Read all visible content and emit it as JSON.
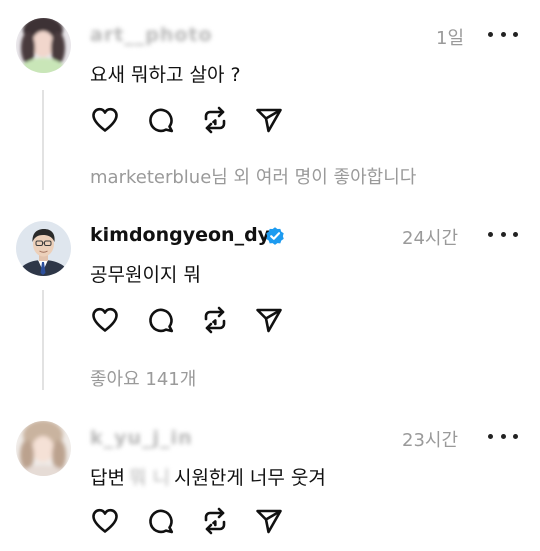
{
  "comments": [
    {
      "username": "art__photo",
      "time": "1일",
      "text": "요새 뭐하고 살아 ?",
      "likes_text": "marketerblue님 외 여러 명이 좋아합니다",
      "avatar_icon": "blurred-profile-photo"
    },
    {
      "username": "kimdongyeon_dy",
      "verified": true,
      "time": "24시간",
      "text": "공무원이지 뭐",
      "likes_text": "좋아요 141개",
      "avatar_icon": "man-in-suit-photo"
    },
    {
      "username": "k_yu_j_in",
      "time": "23시간",
      "text_before": "답변",
      "text_blurred": "뭐 니",
      "text_after": "시원한게 너무 웃겨",
      "avatar_icon": "blurred-profile-photo"
    }
  ],
  "colors": {
    "verified": "#1d9bf0",
    "muted_text": "#9a9a9a",
    "thread_line": "#e2e2e2"
  },
  "icons": [
    "heart-icon",
    "comment-icon",
    "repost-icon",
    "share-icon",
    "more-icon"
  ]
}
